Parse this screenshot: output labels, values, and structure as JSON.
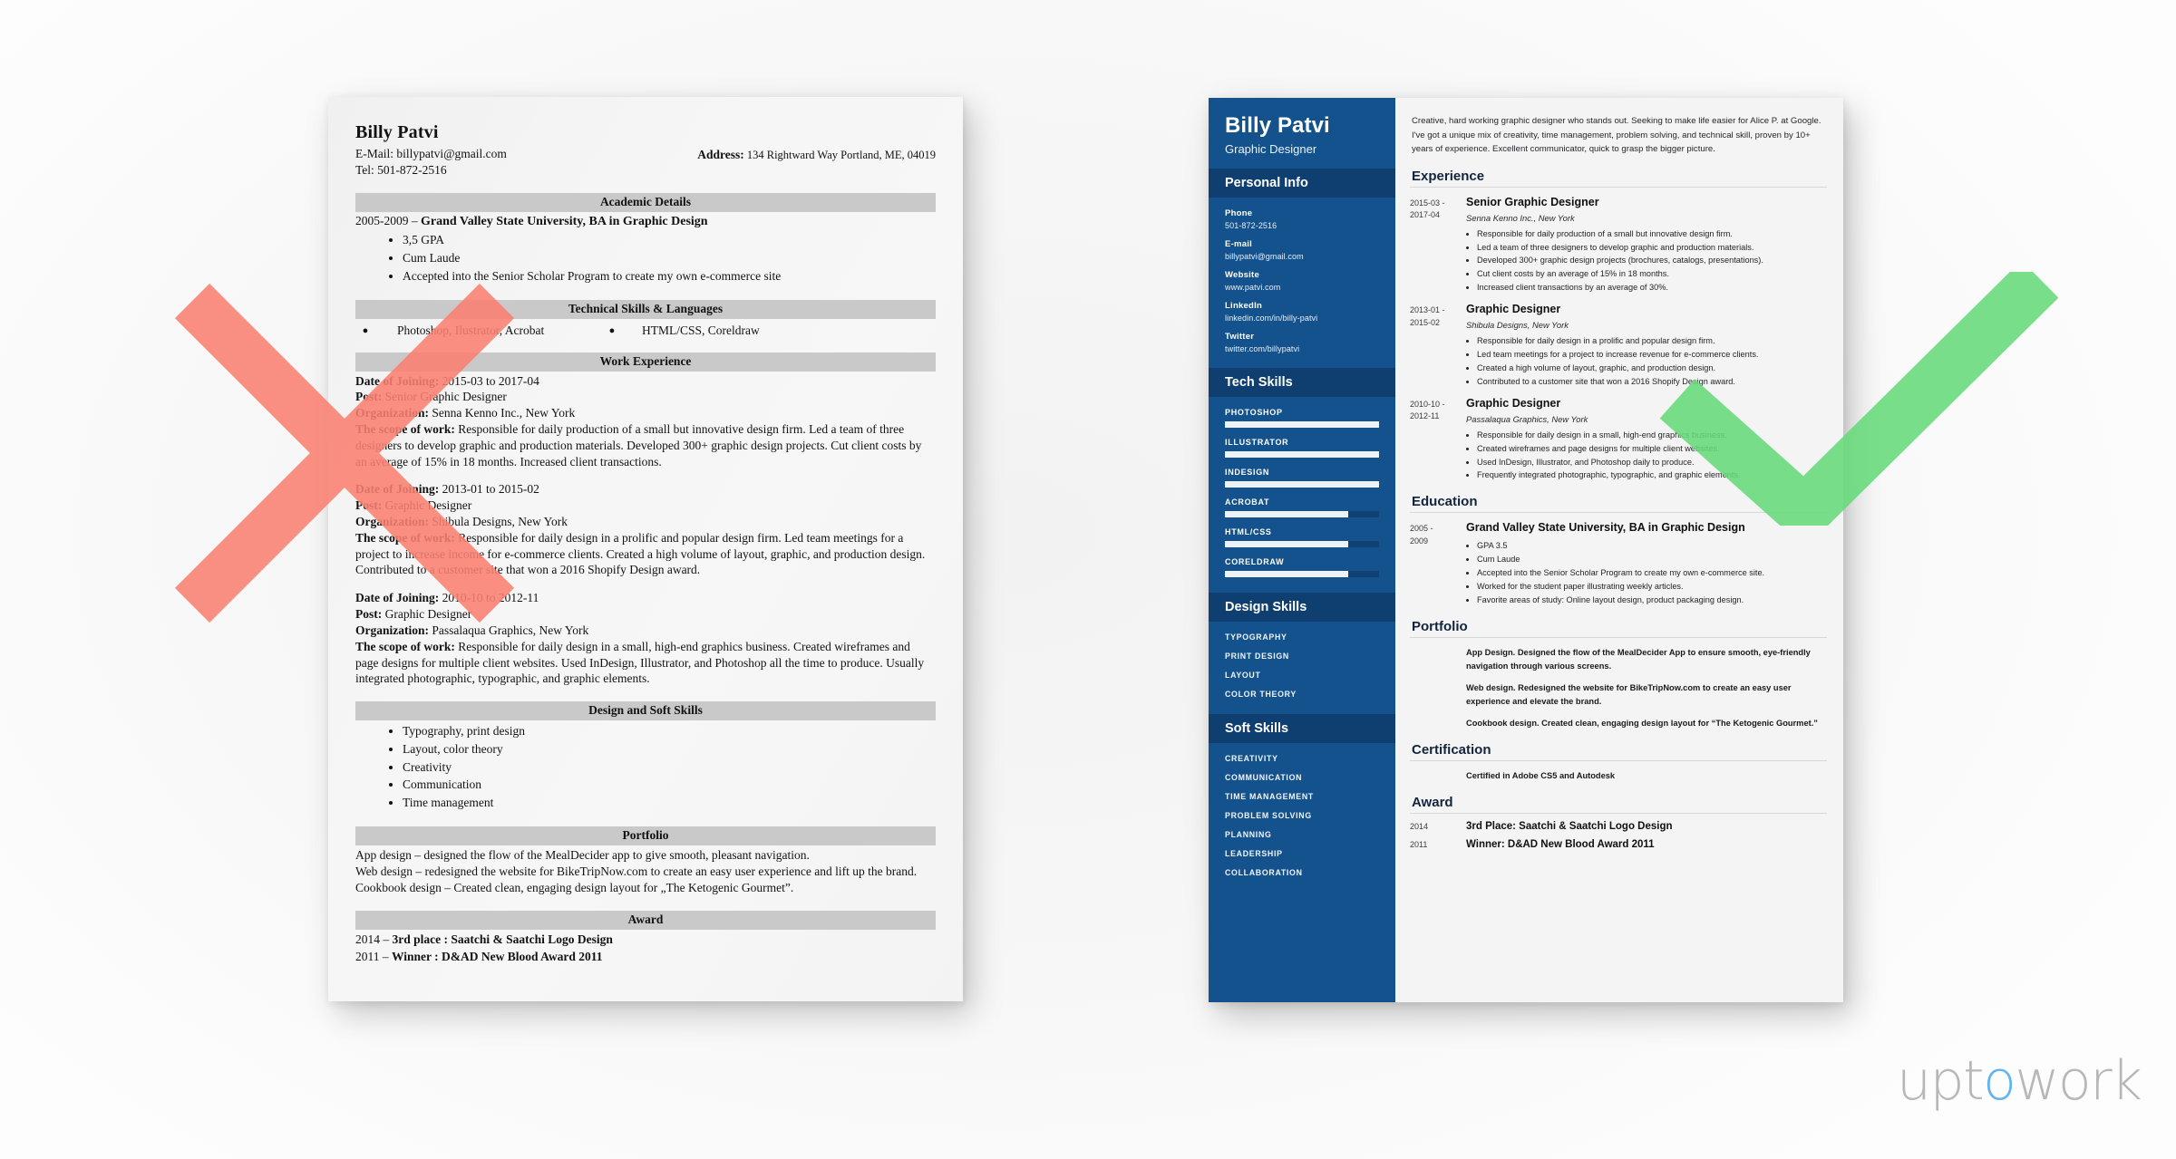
{
  "page": {
    "background_color": "#f6f6f6",
    "x_mark_color": "#fa8072",
    "check_mark_color": "#66d97a"
  },
  "brand": {
    "logo_part1": "upt",
    "logo_accent": "o",
    "logo_part2": "work",
    "accent_color": "#61b4ef",
    "text_color": "#b7b7b7"
  },
  "bad_resume": {
    "name": "Billy Patvi",
    "email_line": "E-Mail: billypatvi@gmail.com",
    "tel_line": "Tel: 501-872-2516",
    "address_label": "Address:",
    "address_value": "134 Rightward Way Portland, ME, 04019",
    "sections": {
      "academic": {
        "heading": "Academic Details",
        "school_years": "2005-2009 – ",
        "school_name": "Grand Valley State University, BA in Graphic Design",
        "bullets": [
          "3,5 GPA",
          "Cum Laude",
          "Accepted into the Senior Scholar Program to create my own e-commerce site"
        ]
      },
      "technical": {
        "heading": "Technical Skills & Languages",
        "col1": "Photoshop, Ilustrator, Acrobat",
        "col2": "HTML/CSS, Coreldraw"
      },
      "work": {
        "heading": "Work Experience",
        "jobs": [
          {
            "date_label": "Date of Joining:",
            "date_value": " 2015-03 to 2017-04",
            "post_label": "Post:",
            "post_value": " Senior Graphic Designer",
            "org_label": "Organization:",
            "org_value": " Senna Kenno Inc., New York",
            "scope_label": "The scope of work:",
            "scope_value": " Responsible for daily production of a small but innovative design firm. Led a team of three designers to develop graphic and production materials. Developed 300+ graphic design projects. Cut client costs by an average of 15% in 18 months. Increased client transactions."
          },
          {
            "date_label": "Date of Joining:",
            "date_value": " 2013-01 to 2015-02",
            "post_label": "Post:",
            "post_value": " Graphic Designer",
            "org_label": "Organization:",
            "org_value": " Shibula Designs, New York",
            "scope_label": "The scope of work:",
            "scope_value": " Responsible for daily design in a prolific and popular design firm. Led team meetings for a project to increase income for e-commerce clients. Created a high volume of layout, graphic, and production design. Contributed to a customer site that won a 2016 Shopify Design award."
          },
          {
            "date_label": "Date of Joining:",
            "date_value": " 2010-10 to 2012-11",
            "post_label": "Post:",
            "post_value": " Graphic Designer",
            "org_label": "Organization:",
            "org_value": " Passalaqua Graphics, New York",
            "scope_label": "The scope of work:",
            "scope_value": " Responsible for daily design in a small, high-end graphics business. Created wireframes and page designs for multiple client websites. Used InDesign, Illustrator, and Photoshop all the time to produce. Usually integrated photographic, typographic, and graphic elements."
          }
        ]
      },
      "design_soft": {
        "heading": "Design and Soft Skills",
        "bullets": [
          "Typography, print design",
          "Layout, color theory",
          "Creativity",
          "Communication",
          "Time management"
        ]
      },
      "portfolio": {
        "heading": "Portfolio",
        "lines": [
          "App design – designed the flow of the MealDecider app to give smooth, pleasant navigation.",
          "Web design – redesigned the website for BikeTripNow.com to create an easy user experience and lift up the brand.",
          "Cookbook design – Created clean, engaging design layout for „The Ketogenic Gourmet”."
        ]
      },
      "award": {
        "heading": "Award",
        "lines": [
          {
            "year": "2014 – ",
            "text": "3rd place : Saatchi & Saatchi Logo Design"
          },
          {
            "year": "2011 – ",
            "text": "Winner : D&AD New Blood Award 2011"
          }
        ]
      }
    }
  },
  "good_resume": {
    "sidebar": {
      "background_color": "#14528d",
      "header_bar_color": "#0e3f70",
      "name": "Billy Patvi",
      "title": "Graphic Designer",
      "personal_info": {
        "heading": "Personal Info",
        "items": [
          {
            "label": "Phone",
            "value": "501-872-2516"
          },
          {
            "label": "E-mail",
            "value": "billypatvi@gmail.com"
          },
          {
            "label": "Website",
            "value": "www.patvi.com"
          },
          {
            "label": "LinkedIn",
            "value": "linkedin.com/in/billy-patvi"
          },
          {
            "label": "Twitter",
            "value": "twitter.com/billypatvi"
          }
        ]
      },
      "tech_skills": {
        "heading": "Tech Skills",
        "items": [
          {
            "name": "PHOTOSHOP",
            "level": 100
          },
          {
            "name": "ILLUSTRATOR",
            "level": 100
          },
          {
            "name": "INDESIGN",
            "level": 100
          },
          {
            "name": "ACROBAT",
            "level": 80
          },
          {
            "name": "HTML/CSS",
            "level": 80
          },
          {
            "name": "CORELDRAW",
            "level": 80
          }
        ]
      },
      "design_skills": {
        "heading": "Design Skills",
        "items": [
          "TYPOGRAPHY",
          "PRINT DESIGN",
          "LAYOUT",
          "COLOR THEORY"
        ]
      },
      "soft_skills": {
        "heading": "Soft Skills",
        "items": [
          "CREATIVITY",
          "COMMUNICATION",
          "TIME MANAGEMENT",
          "PROBLEM SOLVING",
          "PLANNING",
          "LEADERSHIP",
          "COLLABORATION"
        ]
      }
    },
    "main": {
      "summary": "Creative, hard working graphic designer who stands out. Seeking to make life easier for Alice P. at Google. I've got a unique mix of creativity, time management, problem solving, and technical skill, proven by 10+ years of experience. Excellent communicator, quick to grasp the bigger picture.",
      "experience": {
        "heading": "Experience",
        "entries": [
          {
            "date": "2015-03 -\n2017-04",
            "role": "Senior Graphic Designer",
            "org": "Senna Kenno Inc., New York",
            "bullets": [
              "Responsible for daily production of a small but innovative design firm.",
              "Led a team of three designers to develop graphic and production materials.",
              "Developed 300+ graphic design projects (brochures, catalogs, presentations).",
              "Cut client costs by an average of 15% in 18 months.",
              "Increased client transactions by an average of 30%."
            ]
          },
          {
            "date": "2013-01 -\n2015-02",
            "role": "Graphic Designer",
            "org": "Shibula Designs, New York",
            "bullets": [
              "Responsible for daily design in a prolific and popular design firm.",
              "Led team meetings for a project to increase revenue for e-commerce clients.",
              "Created a high volume of layout, graphic, and production design.",
              "Contributed to a customer site that won a 2016 Shopify Design award."
            ]
          },
          {
            "date": "2010-10 -\n2012-11",
            "role": "Graphic Designer",
            "org": "Passalaqua Graphics, New York",
            "bullets": [
              "Responsible for daily design in a small, high-end graphics business.",
              "Created wireframes and page designs for multiple client websites.",
              "Used InDesign, Illustrator, and Photoshop daily to produce.",
              "Frequently integrated photographic, typographic, and graphic elements."
            ]
          }
        ]
      },
      "education": {
        "heading": "Education",
        "entries": [
          {
            "date": "2005 -\n2009",
            "role": "Grand Valley State University, BA in Graphic Design",
            "bullets": [
              "GPA 3.5",
              "Cum Laude",
              "Accepted into the Senior Scholar Program to create my own e-commerce site.",
              "Worked for the student paper illustrating weekly articles.",
              "Favorite areas of study: Online layout design, product packaging design."
            ]
          }
        ]
      },
      "portfolio": {
        "heading": "Portfolio",
        "entries": [
          "App Design. Designed the flow of the MealDecider App to ensure smooth, eye-friendly navigation through various screens.",
          "Web design. Redesigned the website for BikeTripNow.com to create an easy user experience and elevate the brand.",
          "Cookbook design. Created clean, engaging design layout for “The Ketogenic Gourmet.”"
        ]
      },
      "certification": {
        "heading": "Certification",
        "entries": [
          "Certified in Adobe CS5 and Autodesk"
        ]
      },
      "award": {
        "heading": "Award",
        "entries": [
          {
            "year": "2014",
            "text": "3rd Place: Saatchi & Saatchi Logo Design"
          },
          {
            "year": "2011",
            "text": "Winner: D&AD New Blood Award 2011"
          }
        ]
      }
    }
  }
}
